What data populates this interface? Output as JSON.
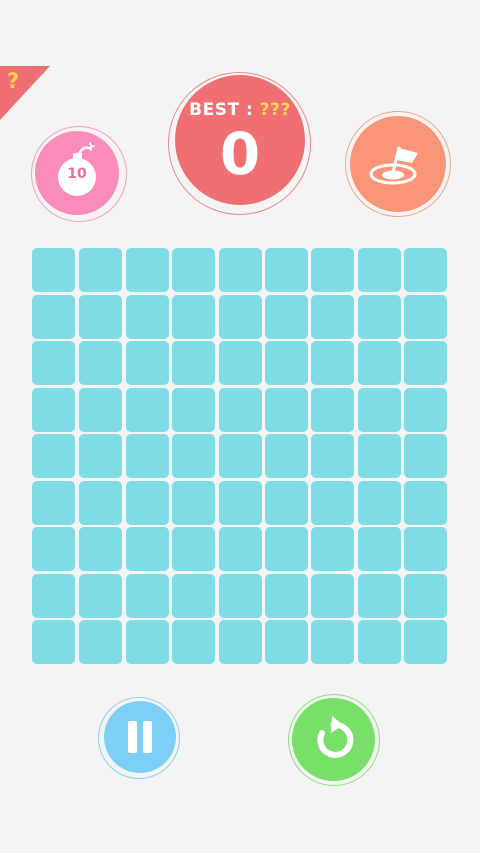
{
  "help": {
    "icon": "question-mark-icon",
    "glyph": "?"
  },
  "bomb": {
    "icon": "bomb-icon",
    "count": "10",
    "color": "#f98cb8"
  },
  "score": {
    "best_label": "BEST : ",
    "best_value": "???",
    "current": "0",
    "color": "#f06f73"
  },
  "flag": {
    "icon": "flag-hole-icon",
    "color": "#fa9677"
  },
  "board": {
    "rows": 9,
    "cols": 9,
    "cell_color": "#7fdce5"
  },
  "controls": {
    "pause": {
      "icon": "pause-icon",
      "color": "#7dcff5"
    },
    "restart": {
      "icon": "restart-icon",
      "color": "#78e068"
    }
  }
}
